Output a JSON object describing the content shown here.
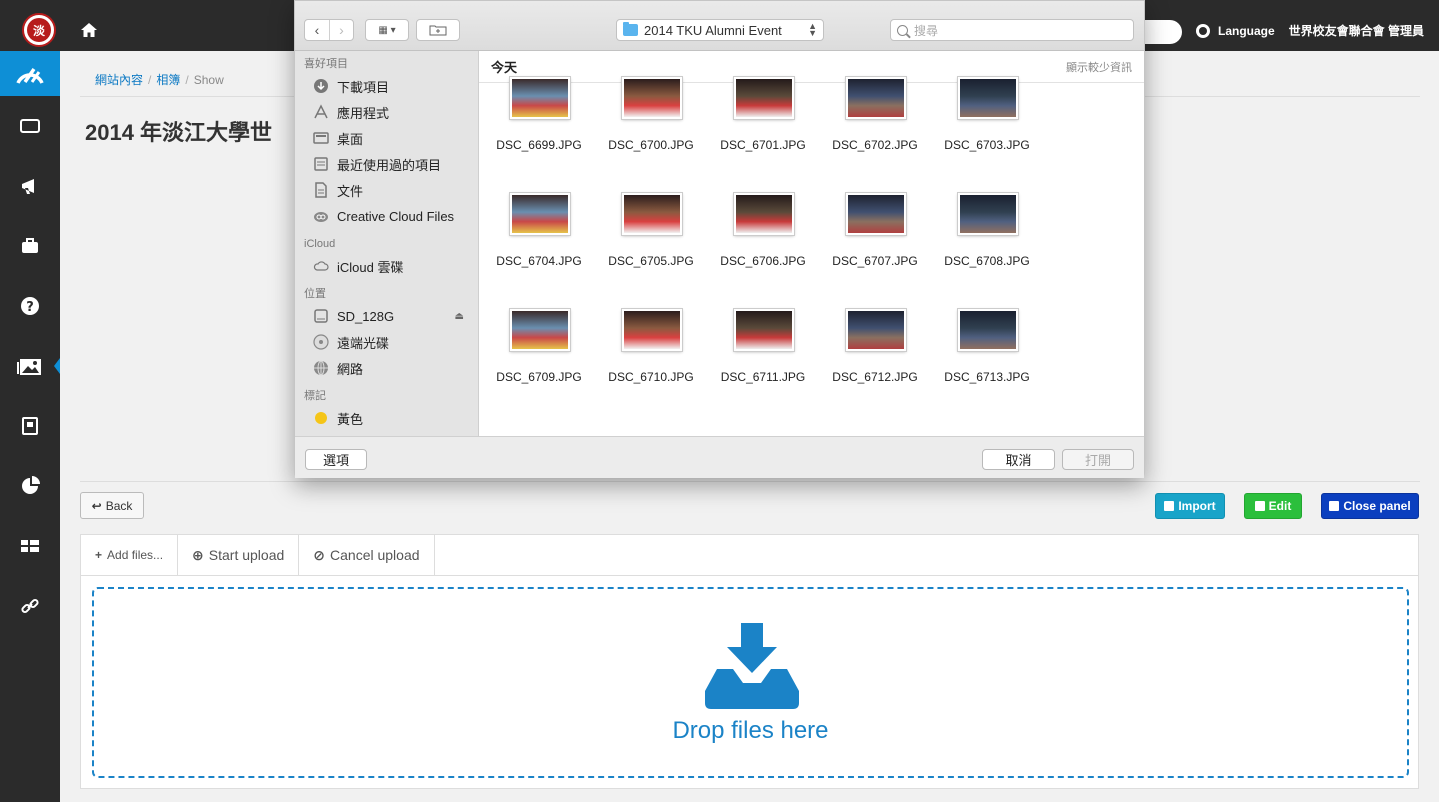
{
  "topbar": {
    "logo_text": "淡",
    "language_label": "Language",
    "user_label": "世界校友會聯合會 管理員"
  },
  "breadcrumb": [
    "網站內容",
    "相簿",
    "Show"
  ],
  "page": {
    "title": "2014 年淡江大學世"
  },
  "actions": {
    "back": "Back",
    "import": "Import",
    "edit": "Edit",
    "close_panel": "Close panel"
  },
  "upload": {
    "add_files": "Add files...",
    "start_upload": "Start upload",
    "cancel_upload": "Cancel upload",
    "drop_text": "Drop files here"
  },
  "dialog": {
    "folder": "2014 TKU Alumni Event",
    "search_placeholder": "搜尋",
    "section_day": "今天",
    "show_less": "顯示較少資訊",
    "favorites_label": "喜好項目",
    "favorites": [
      {
        "label": "下載項目",
        "icon": "download-icon"
      },
      {
        "label": "應用程式",
        "icon": "applications-icon"
      },
      {
        "label": "桌面",
        "icon": "desktop-icon"
      },
      {
        "label": "最近使用過的項目",
        "icon": "recents-icon"
      },
      {
        "label": "文件",
        "icon": "documents-icon"
      },
      {
        "label": "Creative Cloud Files",
        "icon": "creative-cloud-icon"
      }
    ],
    "icloud_label": "iCloud",
    "icloud": [
      {
        "label": "iCloud 雲碟",
        "icon": "cloud-icon"
      }
    ],
    "locations_label": "位置",
    "locations": [
      {
        "label": "SD_128G",
        "icon": "drive-icon",
        "eject": "⏏"
      },
      {
        "label": "遠端光碟",
        "icon": "disc-icon"
      },
      {
        "label": "網路",
        "icon": "network-icon"
      }
    ],
    "tags_label": "標記",
    "tags": [
      {
        "label": "黃色",
        "icon": "yellow-tag-icon",
        "color": "#f5c518"
      }
    ],
    "files": [
      "DSC_6699.JPG",
      "DSC_6700.JPG",
      "DSC_6701.JPG",
      "DSC_6702.JPG",
      "DSC_6703.JPG",
      "DSC_6704.JPG",
      "DSC_6705.JPG",
      "DSC_6706.JPG",
      "DSC_6707.JPG",
      "DSC_6708.JPG",
      "DSC_6709.JPG",
      "DSC_6710.JPG",
      "DSC_6711.JPG",
      "DSC_6712.JPG",
      "DSC_6713.JPG"
    ],
    "options_button": "選項",
    "cancel_button": "取消",
    "open_button": "打開"
  },
  "colors": {
    "accent": "#0e8fd6",
    "import": "#19a4c9",
    "edit": "#2bbf3c",
    "close": "#0b3fbf",
    "drop": "#1b83c7"
  }
}
